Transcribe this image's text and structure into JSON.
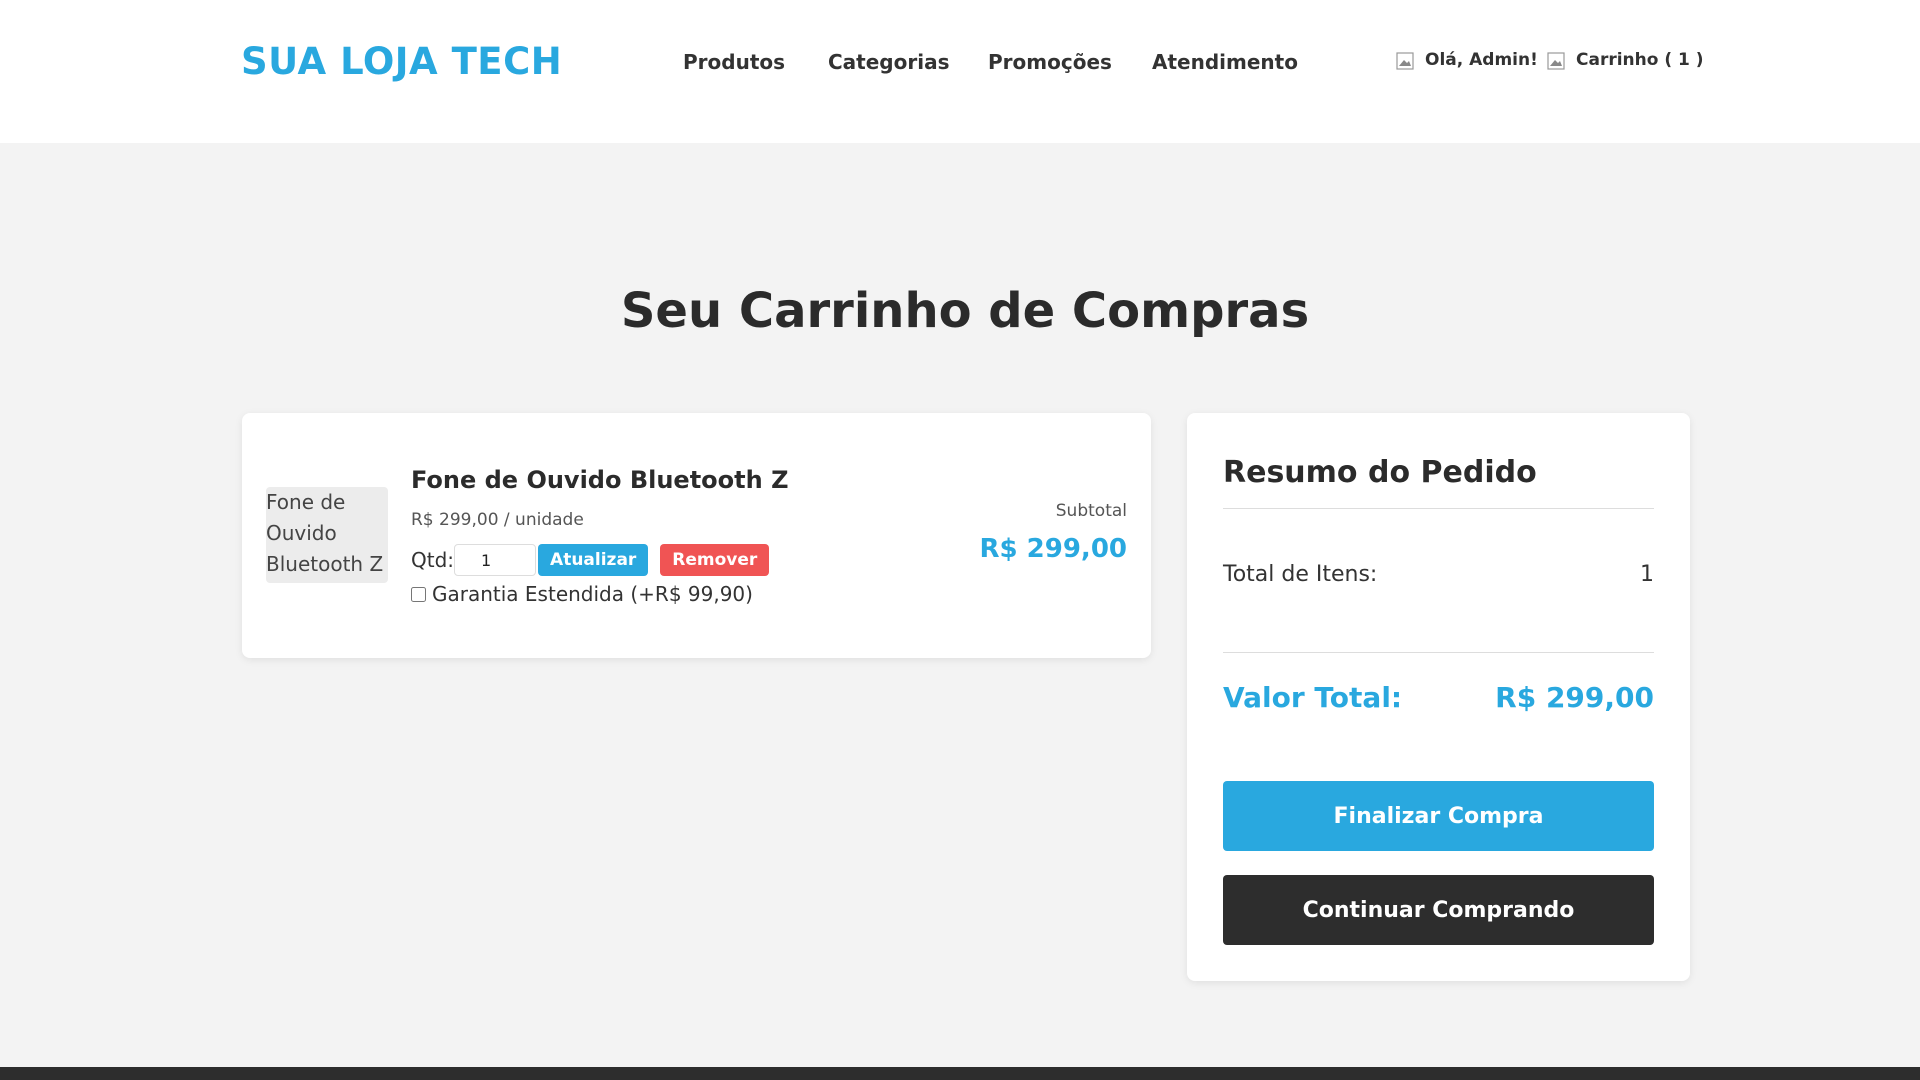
{
  "header": {
    "logo": "SUA LOJA TECH",
    "nav": [
      "Produtos",
      "Categorias",
      "Promoções",
      "Atendimento"
    ],
    "greeting": "Olá, Admin!",
    "cart_label": "Carrinho ( 1 )"
  },
  "page": {
    "title": "Seu Carrinho de Compras"
  },
  "cart_item": {
    "image_alt": "Fone de Ouvido Bluetooth Z",
    "name": "Fone de Ouvido Bluetooth Z",
    "unit_price": "R$ 299,00 / unidade",
    "qty_label": "Qtd:",
    "qty_value": "1",
    "update_label": "Atualizar",
    "remove_label": "Remover",
    "warranty_label": "Garantia Estendida (+R$ 99,90)",
    "subtotal_label": "Subtotal",
    "subtotal_value": "R$ 299,00"
  },
  "summary": {
    "title": "Resumo do Pedido",
    "items_label": "Total de Itens:",
    "items_value": "1",
    "total_label": "Valor Total:",
    "total_value": "R$ 299,00",
    "checkout_label": "Finalizar Compra",
    "continue_label": "Continuar Comprando"
  },
  "colors": {
    "accent": "#29a8df",
    "danger": "#f05454",
    "dark": "#2d2d2d",
    "background": "#f3f3f3"
  }
}
